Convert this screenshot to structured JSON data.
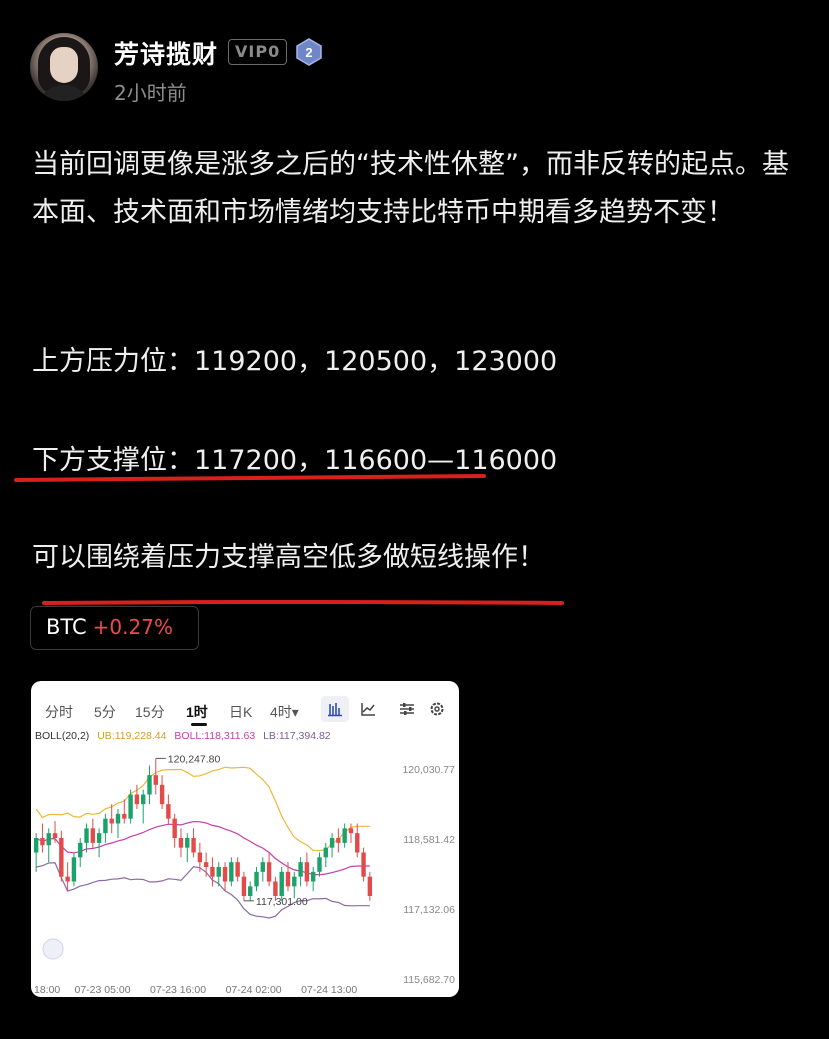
{
  "post": {
    "author": "芳诗揽财",
    "vip_label": "VIP0",
    "level": "2",
    "time": "2小时前",
    "paragraph1": "当前回调更像是涨多之后的“技术性休整”，而非反转的起点。基本面、技术面和市场情绪均支持比特币中期看多趋势不变！",
    "paragraph2": "上方压力位：119200，120500，123000",
    "paragraph3": "下方支撑位：117200，116600—116000",
    "paragraph4": "可以围绕着压力支撑高空低多做短线操作！",
    "annotation_color": "#d8211c"
  },
  "ticker": {
    "symbol": "BTC",
    "change": "+0.27%",
    "change_color": "#f0494b"
  },
  "chart": {
    "tabs": [
      "分时",
      "5分",
      "15分",
      "1时",
      "日K",
      "4时▾"
    ],
    "active_tab": "1时",
    "tool_icons": [
      "candle-chart-icon",
      "line-chart-icon",
      "indicator-settings-icon",
      "settings-gear-icon"
    ],
    "boll_label": "BOLL(20,2)",
    "ub_label": "UB:119,228.44",
    "boll_mid_label": "BOLL:118,311.63",
    "lb_label": "LB:117,394.82",
    "colors": {
      "up": "#1aa26a",
      "down": "#e34b4b",
      "ub": "#e9b93a",
      "mid": "#c83ca8",
      "lb": "#8a6aa8"
    }
  },
  "chart_data": {
    "type": "candlestick",
    "title": "",
    "ylim": [
      115682.7,
      120400
    ],
    "y_ticks": [
      "120,030.77",
      "118,581.42",
      "117,132.06",
      "115,682.70"
    ],
    "x_ticks": [
      "18:00",
      "07-23 05:00",
      "07-23 16:00",
      "07-24 02:00",
      "07-24 13:00"
    ],
    "annotations": {
      "high": "120,247.80",
      "low": "117,301.00"
    },
    "candles": [
      [
        118300,
        118700,
        117900,
        118600
      ],
      [
        118600,
        118900,
        118300,
        118450
      ],
      [
        118450,
        118800,
        118100,
        118700
      ],
      [
        118700,
        118950,
        118500,
        118600
      ],
      [
        118600,
        118750,
        117700,
        117800
      ],
      [
        117800,
        118100,
        117500,
        117700
      ],
      [
        117700,
        118300,
        117600,
        118200
      ],
      [
        118200,
        118600,
        118000,
        118500
      ],
      [
        118500,
        118900,
        118300,
        118800
      ],
      [
        118800,
        119000,
        118400,
        118500
      ],
      [
        118500,
        118800,
        118200,
        118700
      ],
      [
        118700,
        119100,
        118500,
        119000
      ],
      [
        119000,
        119300,
        118700,
        118900
      ],
      [
        118900,
        119200,
        118600,
        119100
      ],
      [
        119100,
        119400,
        118900,
        119000
      ],
      [
        119000,
        119600,
        118900,
        119500
      ],
      [
        119500,
        119700,
        119200,
        119300
      ],
      [
        119300,
        119600,
        118900,
        119500
      ],
      [
        119500,
        120100,
        119300,
        119900
      ],
      [
        119900,
        120247.8,
        119500,
        119700
      ],
      [
        119700,
        119900,
        119200,
        119300
      ],
      [
        119300,
        119500,
        118900,
        119000
      ],
      [
        119000,
        119100,
        118400,
        118600
      ],
      [
        118600,
        118800,
        118200,
        118400
      ],
      [
        118400,
        118700,
        118100,
        118600
      ],
      [
        118600,
        118800,
        118200,
        118300
      ],
      [
        118300,
        118500,
        117900,
        118100
      ],
      [
        118100,
        118300,
        117800,
        118000
      ],
      [
        118000,
        118200,
        117600,
        117800
      ],
      [
        117800,
        118100,
        117600,
        118000
      ],
      [
        118000,
        118100,
        117500,
        117700
      ],
      [
        117700,
        118200,
        117600,
        118100
      ],
      [
        118100,
        118200,
        117700,
        117800
      ],
      [
        117800,
        117900,
        117300,
        117400
      ],
      [
        117400,
        117700,
        117301,
        117600
      ],
      [
        117600,
        118000,
        117500,
        117900
      ],
      [
        117900,
        118200,
        117700,
        118100
      ],
      [
        118100,
        118300,
        117600,
        117700
      ],
      [
        117700,
        117800,
        117300,
        117400
      ],
      [
        117400,
        118000,
        117300,
        117900
      ],
      [
        117900,
        118100,
        117500,
        117600
      ],
      [
        117600,
        117900,
        117350,
        117800
      ],
      [
        117800,
        118200,
        117600,
        118100
      ],
      [
        118100,
        118300,
        117600,
        117700
      ],
      [
        117700,
        118000,
        117500,
        117900
      ],
      [
        117900,
        118300,
        117800,
        118200
      ],
      [
        118200,
        118500,
        118000,
        118400
      ],
      [
        118400,
        118700,
        118200,
        118600
      ],
      [
        118600,
        118800,
        118300,
        118500
      ],
      [
        118500,
        118900,
        118400,
        118800
      ],
      [
        118800,
        118900,
        118500,
        118700
      ],
      [
        118700,
        118900,
        118200,
        118300
      ],
      [
        118300,
        118400,
        117700,
        117800
      ],
      [
        117800,
        117900,
        117300,
        117400
      ]
    ]
  }
}
